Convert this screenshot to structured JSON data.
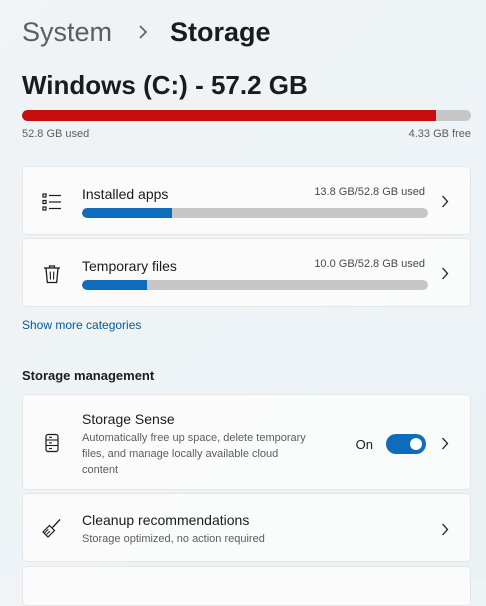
{
  "breadcrumb": {
    "parent": "System",
    "current": "Storage"
  },
  "drive": {
    "title": "Windows (C:) - 57.2 GB",
    "used_label": "52.8 GB used",
    "free_label": "4.33 GB free",
    "used_fraction": 0.923,
    "bar_color": "#c50f0f"
  },
  "categories": [
    {
      "title": "Installed apps",
      "size": "13.8 GB/52.8 GB used",
      "fraction": 0.261,
      "icon": "list-icon"
    },
    {
      "title": "Temporary files",
      "size": "10.0 GB/52.8 GB used",
      "fraction": 0.189,
      "icon": "trash-icon"
    }
  ],
  "show_more_label": "Show more categories",
  "storage_management": {
    "heading": "Storage management",
    "storage_sense": {
      "title": "Storage Sense",
      "description_line1": "Automatically free up space, delete temporary",
      "description_line2": "files, and manage locally available cloud",
      "description_line3": "content",
      "toggle_label": "On",
      "toggle_on": true,
      "icon": "drive-icon"
    },
    "cleanup": {
      "title": "Cleanup recommendations",
      "description": "Storage optimized, no action required",
      "icon": "broom-icon"
    }
  },
  "colors": {
    "accent": "#0f6cbd",
    "link": "#005a9e",
    "drive_bar": "#c50f0f"
  }
}
